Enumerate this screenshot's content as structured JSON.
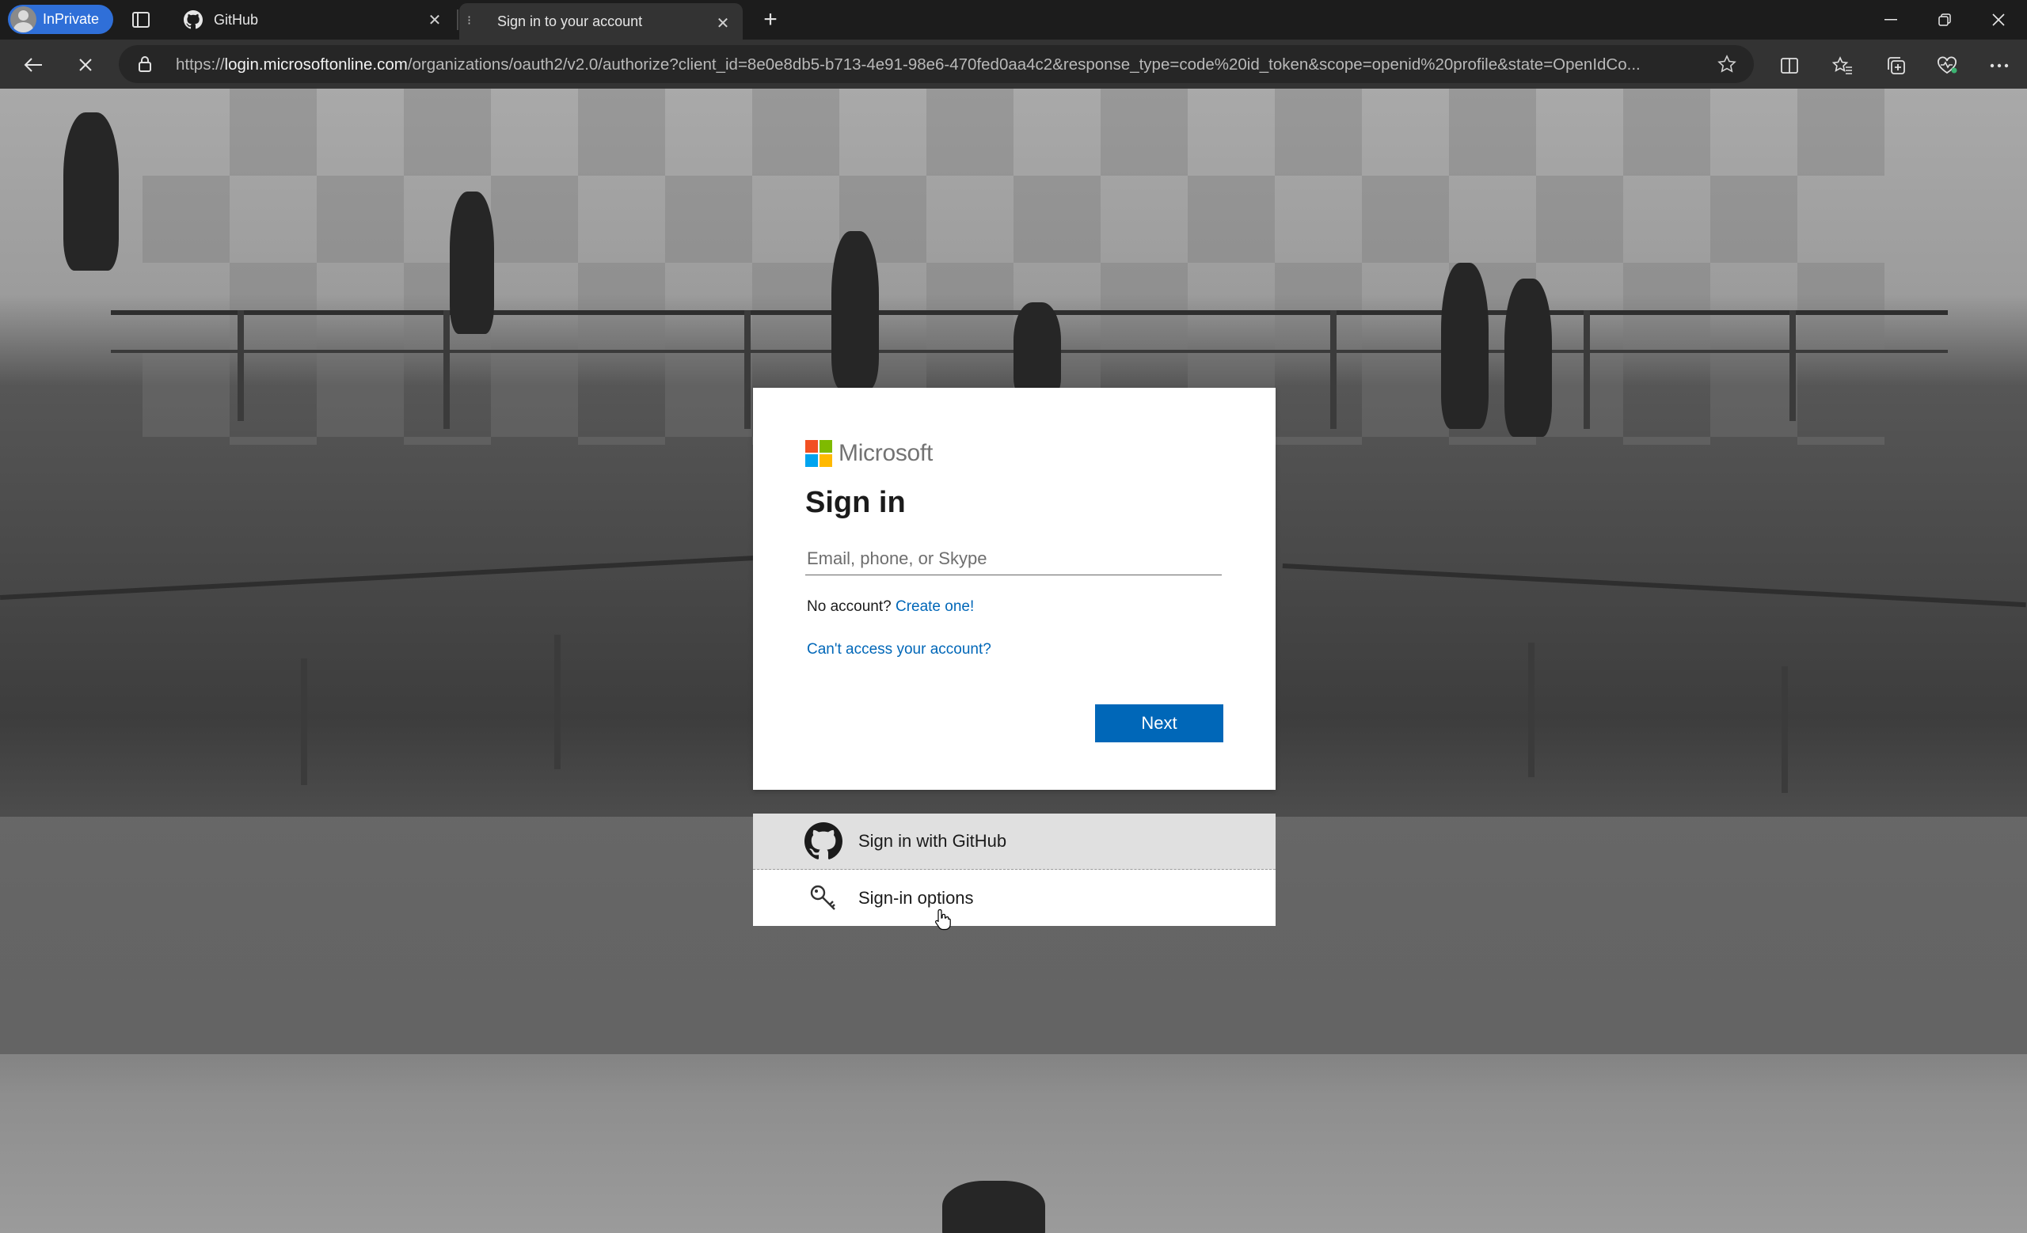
{
  "browser": {
    "inprivate_label": "InPrivate",
    "tabs": [
      {
        "title": "GitHub",
        "active": false
      },
      {
        "title": "Sign in to your account",
        "active": true
      }
    ],
    "url_prefix": "https://",
    "url_host": "login.microsoftonline.com",
    "url_path": "/organizations/oauth2/v2.0/authorize?client_id=8e0e8db5-b713-4e91-98e6-470fed0aa4c2&response_type=code%20id_token&scope=openid%20profile&state=OpenIdCo..."
  },
  "signin": {
    "brand": "Microsoft",
    "title": "Sign in",
    "email_placeholder": "Email, phone, or Skype",
    "no_account_text": "No account?",
    "create_link": "Create one!",
    "cant_access": "Can't access your account?",
    "next_label": "Next"
  },
  "options": {
    "github_label": "Sign in with GitHub",
    "signin_options_label": "Sign-in options"
  },
  "colors": {
    "accent": "#0067b8",
    "inprivate": "#2f6fd8"
  }
}
